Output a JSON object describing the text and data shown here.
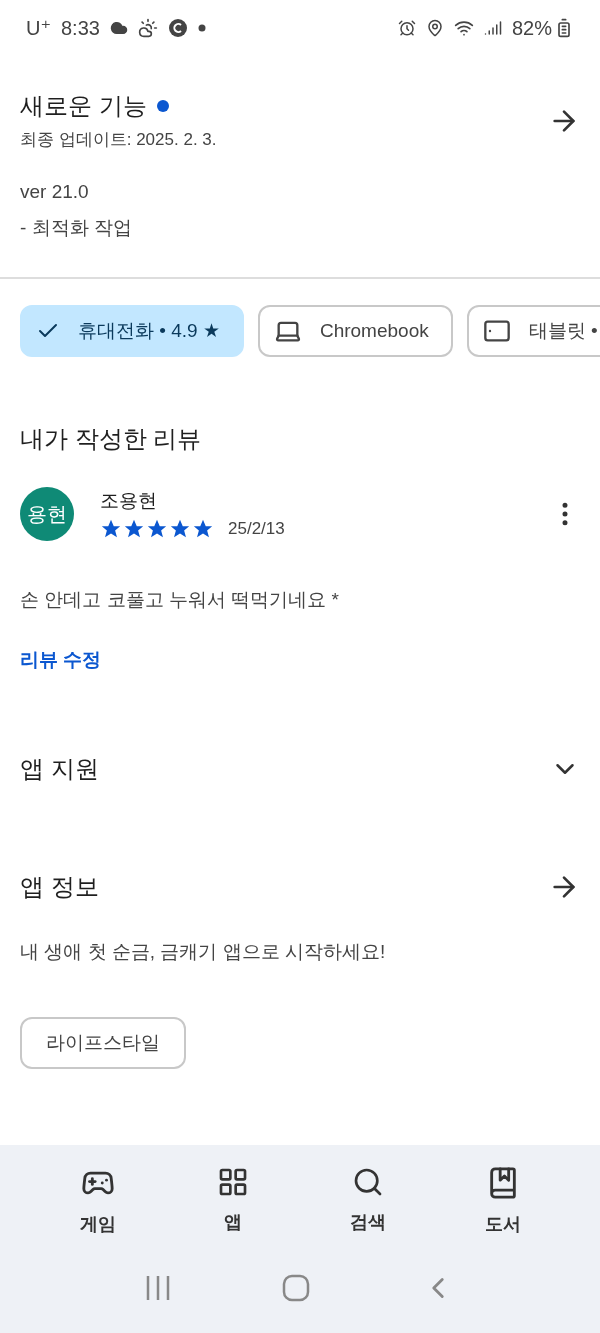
{
  "status_bar": {
    "carrier": "U⁺",
    "time": "8:33",
    "battery": "82%"
  },
  "whats_new": {
    "title": "새로운 기능",
    "updated": "최종 업데이트: 2025. 2. 3.",
    "version": "ver 21.0",
    "notes": "- 최적화 작업"
  },
  "device_chips": [
    {
      "kind": "phone",
      "label": "휴대전화 • 4.9 ★",
      "selected": true
    },
    {
      "kind": "laptop",
      "label": "Chromebook",
      "selected": false
    },
    {
      "kind": "tablet",
      "label": "태블릿 •",
      "selected": false
    }
  ],
  "my_review": {
    "heading": "내가 작성한 리뷰",
    "avatar": "용현",
    "author": "조용현",
    "stars": 5,
    "date": "25/2/13",
    "text": "손 안데고 코풀고 누워서 떡먹기네요 *",
    "edit_link": "리뷰 수정"
  },
  "app_support": {
    "title": "앱 지원"
  },
  "app_info": {
    "title": "앱 정보",
    "description": "내 생애 첫 순금, 금캐기 앱으로 시작하세요!",
    "category": "라이프스타일"
  },
  "bottom_nav": [
    {
      "kind": "games",
      "label": "게임"
    },
    {
      "kind": "apps",
      "label": "앱"
    },
    {
      "kind": "search",
      "label": "검색"
    },
    {
      "kind": "books",
      "label": "도서"
    }
  ]
}
